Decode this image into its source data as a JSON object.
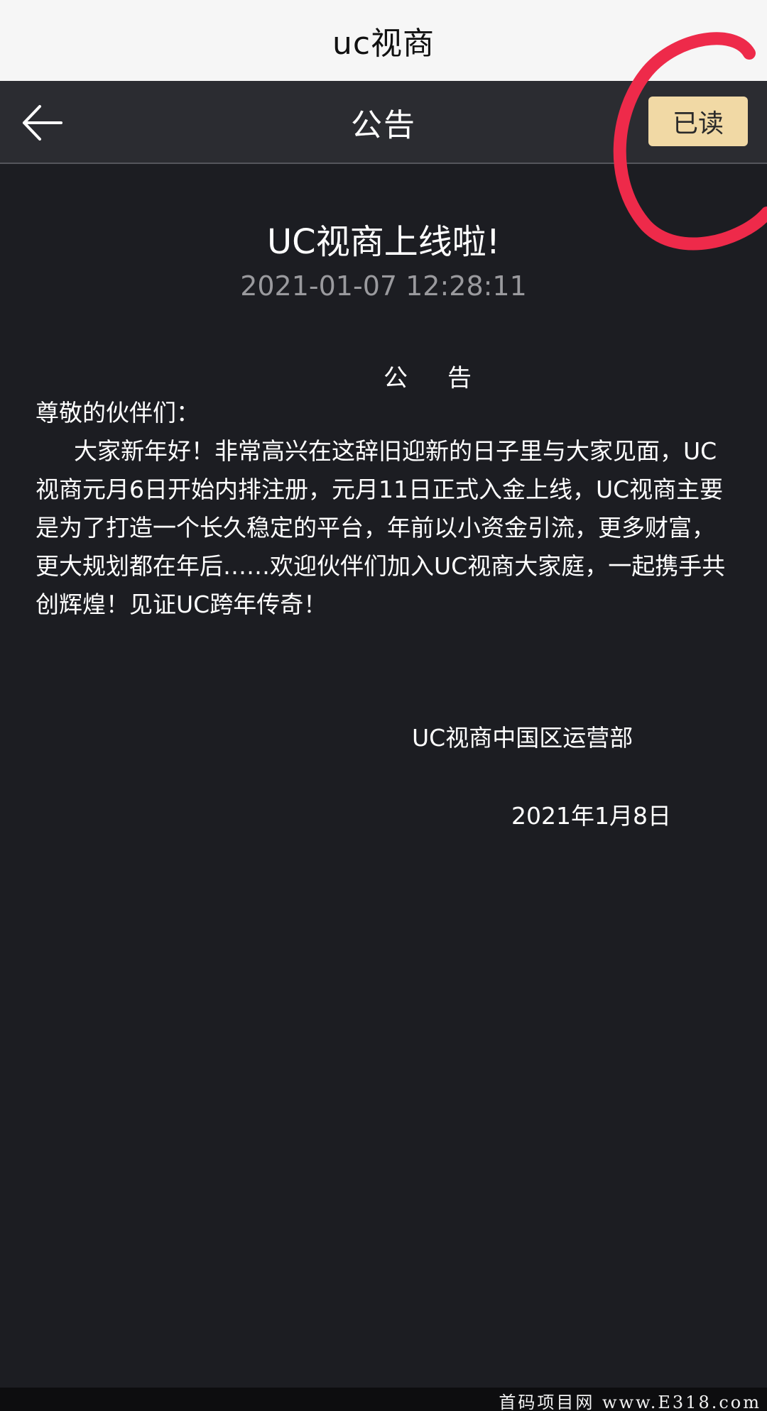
{
  "browser": {
    "title": "uc视商"
  },
  "navbar": {
    "back_icon": "arrow-left-icon",
    "title": "公告",
    "read_button_label": "已读"
  },
  "notice": {
    "title": "UC视商上线啦!",
    "datetime": "2021-01-07 12:28:11",
    "heading": "公告",
    "greeting": "尊敬的伙伴们：",
    "body": "大家新年好！非常高兴在这辞旧迎新的日子里与大家见面，UC视商元月6日开始内排注册，元月11日正式入金上线，UC视商主要是为了打造一个长久稳定的平台，年前以小资金引流，更多财富，更大规划都在年后……欢迎伙伴们加入UC视商大家庭，一起携手共创辉煌！见证UC跨年传奇！",
    "signature": "UC视商中国区运营部",
    "signature_date": "2021年1月8日"
  },
  "watermark": {
    "text": "首码项目网 www.E318.com"
  },
  "colors": {
    "page_background": "#1c1d22",
    "navbar_background": "#2b2c31",
    "read_button": "#f1d9a5",
    "annotation": "#ee2a4a"
  }
}
